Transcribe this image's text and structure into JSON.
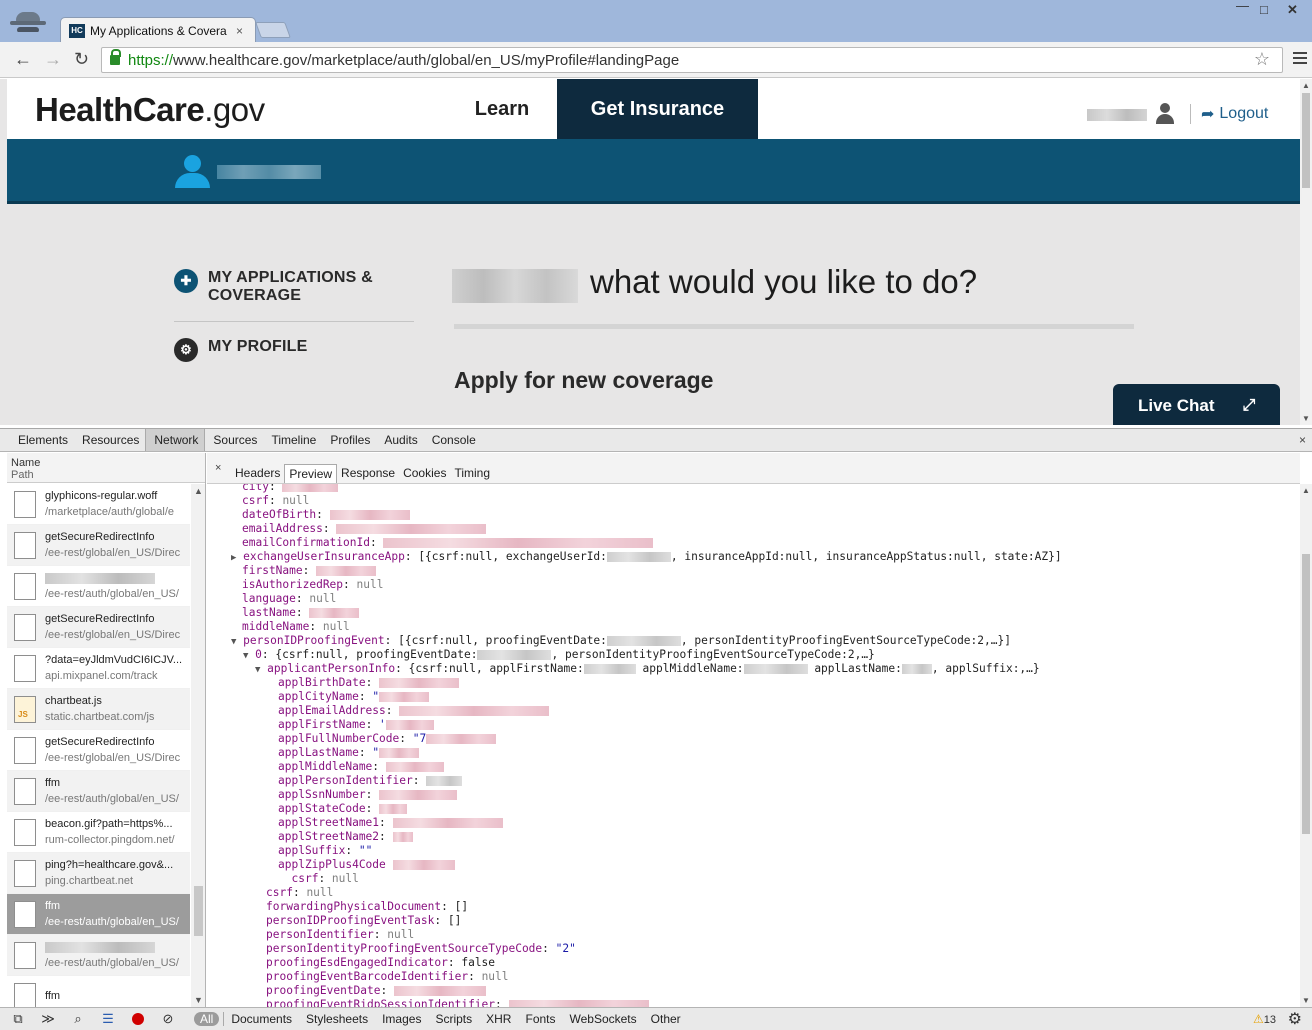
{
  "browser": {
    "tab_title": "My Applications & Covera",
    "tab_favicon": "HC",
    "tab_close": "×",
    "url_scheme": "https://",
    "url_rest": "www.healthcare.gov/marketplace/auth/global/en_US/myProfile#landingPage",
    "star": "☆",
    "win_min": "—",
    "win_max": "□",
    "win_close": "✕"
  },
  "site": {
    "logo_main": "HealthCare",
    "logo_dot": ".",
    "logo_gov": "gov",
    "nav_learn": "Learn",
    "nav_get_insurance": "Get Insurance",
    "logout": "Logout",
    "logout_arrow": "➦",
    "side_menu": {
      "applications": "MY APPLICATIONS & COVERAGE",
      "profile": "MY PROFILE"
    },
    "greeting": "what would you like to do?",
    "apply_heading": "Apply for new coverage",
    "live_chat": "Live Chat",
    "live_chat_expand": "⤢"
  },
  "devtools": {
    "tabs": [
      "Elements",
      "Resources",
      "Network",
      "Sources",
      "Timeline",
      "Profiles",
      "Audits",
      "Console"
    ],
    "close": "×",
    "list_header_name": "Name",
    "list_header_path": "Path",
    "requests": [
      {
        "name": "glyphicons-regular.woff",
        "path": "/marketplace/auth/global/e"
      },
      {
        "name": "getSecureRedirectInfo",
        "path": "/ee-rest/global/en_US/Direc"
      },
      {
        "name": "",
        "path": "/ee-rest/auth/global/en_US/"
      },
      {
        "name": "getSecureRedirectInfo",
        "path": "/ee-rest/global/en_US/Direc"
      },
      {
        "name": "?data=eyJldmVudCI6ICJV...",
        "path": "api.mixpanel.com/track"
      },
      {
        "name": "chartbeat.js",
        "path": "static.chartbeat.com/js"
      },
      {
        "name": "getSecureRedirectInfo",
        "path": "/ee-rest/global/en_US/Direc"
      },
      {
        "name": "ffm",
        "path": "/ee-rest/auth/global/en_US/"
      },
      {
        "name": "beacon.gif?path=https%...",
        "path": "rum-collector.pingdom.net/"
      },
      {
        "name": "ping?h=healthcare.gov&...",
        "path": "ping.chartbeat.net"
      },
      {
        "name": "ffm",
        "path": "/ee-rest/auth/global/en_US/"
      },
      {
        "name": "",
        "path": "/ee-rest/auth/global/en_US/"
      },
      {
        "name": "ffm",
        "path": ""
      }
    ],
    "detail_close": "×",
    "detail_tabs": [
      "Headers",
      "Preview",
      "Response",
      "Cookies",
      "Timing"
    ],
    "preview": {
      "city": "city",
      "csrf": "csrf",
      "null": "null",
      "dateOfBirth": "dateOfBirth",
      "emailAddress": "emailAddress",
      "emailConfirmationId": "emailConfirmationId",
      "exchangeUserInsuranceApp": "exchangeUserInsuranceApp",
      "exchangeUserInsuranceApp_val_a": "[{csrf:null, exchangeUserId:",
      "exchangeUserInsuranceApp_val_b": ", insuranceAppId:null, insuranceAppStatus:null, state:AZ}]",
      "firstName": "firstName",
      "isAuthorizedRep": "isAuthorizedRep",
      "language": "language",
      "lastName": "lastName",
      "middleName": "middleName",
      "personIDProofingEvent": "personIDProofingEvent",
      "personIDProofingEvent_val_a": "[{csrf:null, proofingEventDate:",
      "personIDProofingEvent_val_b": ", personIdentityProofingEventSourceTypeCode:2,…}]",
      "idx0": "0",
      "idx0_val_a": "{csrf:null, proofingEventDate:",
      "idx0_val_b": ", personIdentityProofingEventSourceTypeCode:2,…}",
      "applicantPersonInfo": "applicantPersonInfo",
      "applicantPersonInfo_val_a": "{csrf:null, applFirstName:",
      "applicantPersonInfo_val_b": "applMiddleName:",
      "applicantPersonInfo_val_c": "applLastName:",
      "applicantPersonInfo_val_d": ", applSuffix:,…}",
      "applBirthDate": "applBirthDate",
      "applCityName": "applCityName",
      "applCityName_val": "\"",
      "applEmailAddress": "applEmailAddress",
      "applFirstName": "applFirstName",
      "applFirstName_val": "'",
      "applFullNumberCode": "applFullNumberCode",
      "applFullNumberCode_val": "\"7",
      "applLastName": "applLastName",
      "applLastName_val": "\"",
      "applMiddleName": "applMiddleName",
      "applPersonIdentifier": "applPersonIdentifier",
      "applSsnNumber": "applSsnNumber",
      "applStateCode": "applStateCode",
      "applStreetName1": "applStreetName1",
      "applStreetName2": "applStreetName2",
      "applSuffix": "applSuffix",
      "applSuffix_val": "\"\"",
      "applZipPlus4Code": "applZipPlus4Code",
      "forwardingPhysicalDocument": "forwardingPhysicalDocument",
      "empty_array": "[]",
      "personIDProofingEventTask": "personIDProofingEventTask",
      "personIdentifier": "personIdentifier",
      "personIdentityProofingEventSourceTypeCode": "personIdentityProofingEventSourceTypeCode",
      "personIdentityProofingEventSourceTypeCode_val": "\"2\"",
      "proofingEsdEngagedIndicator": "proofingEsdEngagedIndicator",
      "false": "false",
      "proofingEventBarcodeIdentifier": "proofingEventBarcodeIdentifier",
      "proofingEventDate": "proofingEventDate",
      "proofingEventRidpSessionIdentifier": "proofingEventRidpSessionIdentifier"
    },
    "filters": [
      "All",
      "Documents",
      "Stylesheets",
      "Images",
      "Scripts",
      "XHR",
      "Fonts",
      "WebSockets",
      "Other"
    ],
    "warnings_count": "13",
    "icons": [
      "dock-icon",
      "console-drawer-icon",
      "search-icon",
      "list-view-icon",
      "record-icon",
      "clear-icon",
      "settings-icon"
    ]
  },
  "colors": {
    "header_dark": "#0e2a3e",
    "teal_bar": "#0d5374",
    "accent_blue": "#1aa3e0",
    "json_key": "#881280",
    "json_string": "#1a1aa6"
  }
}
